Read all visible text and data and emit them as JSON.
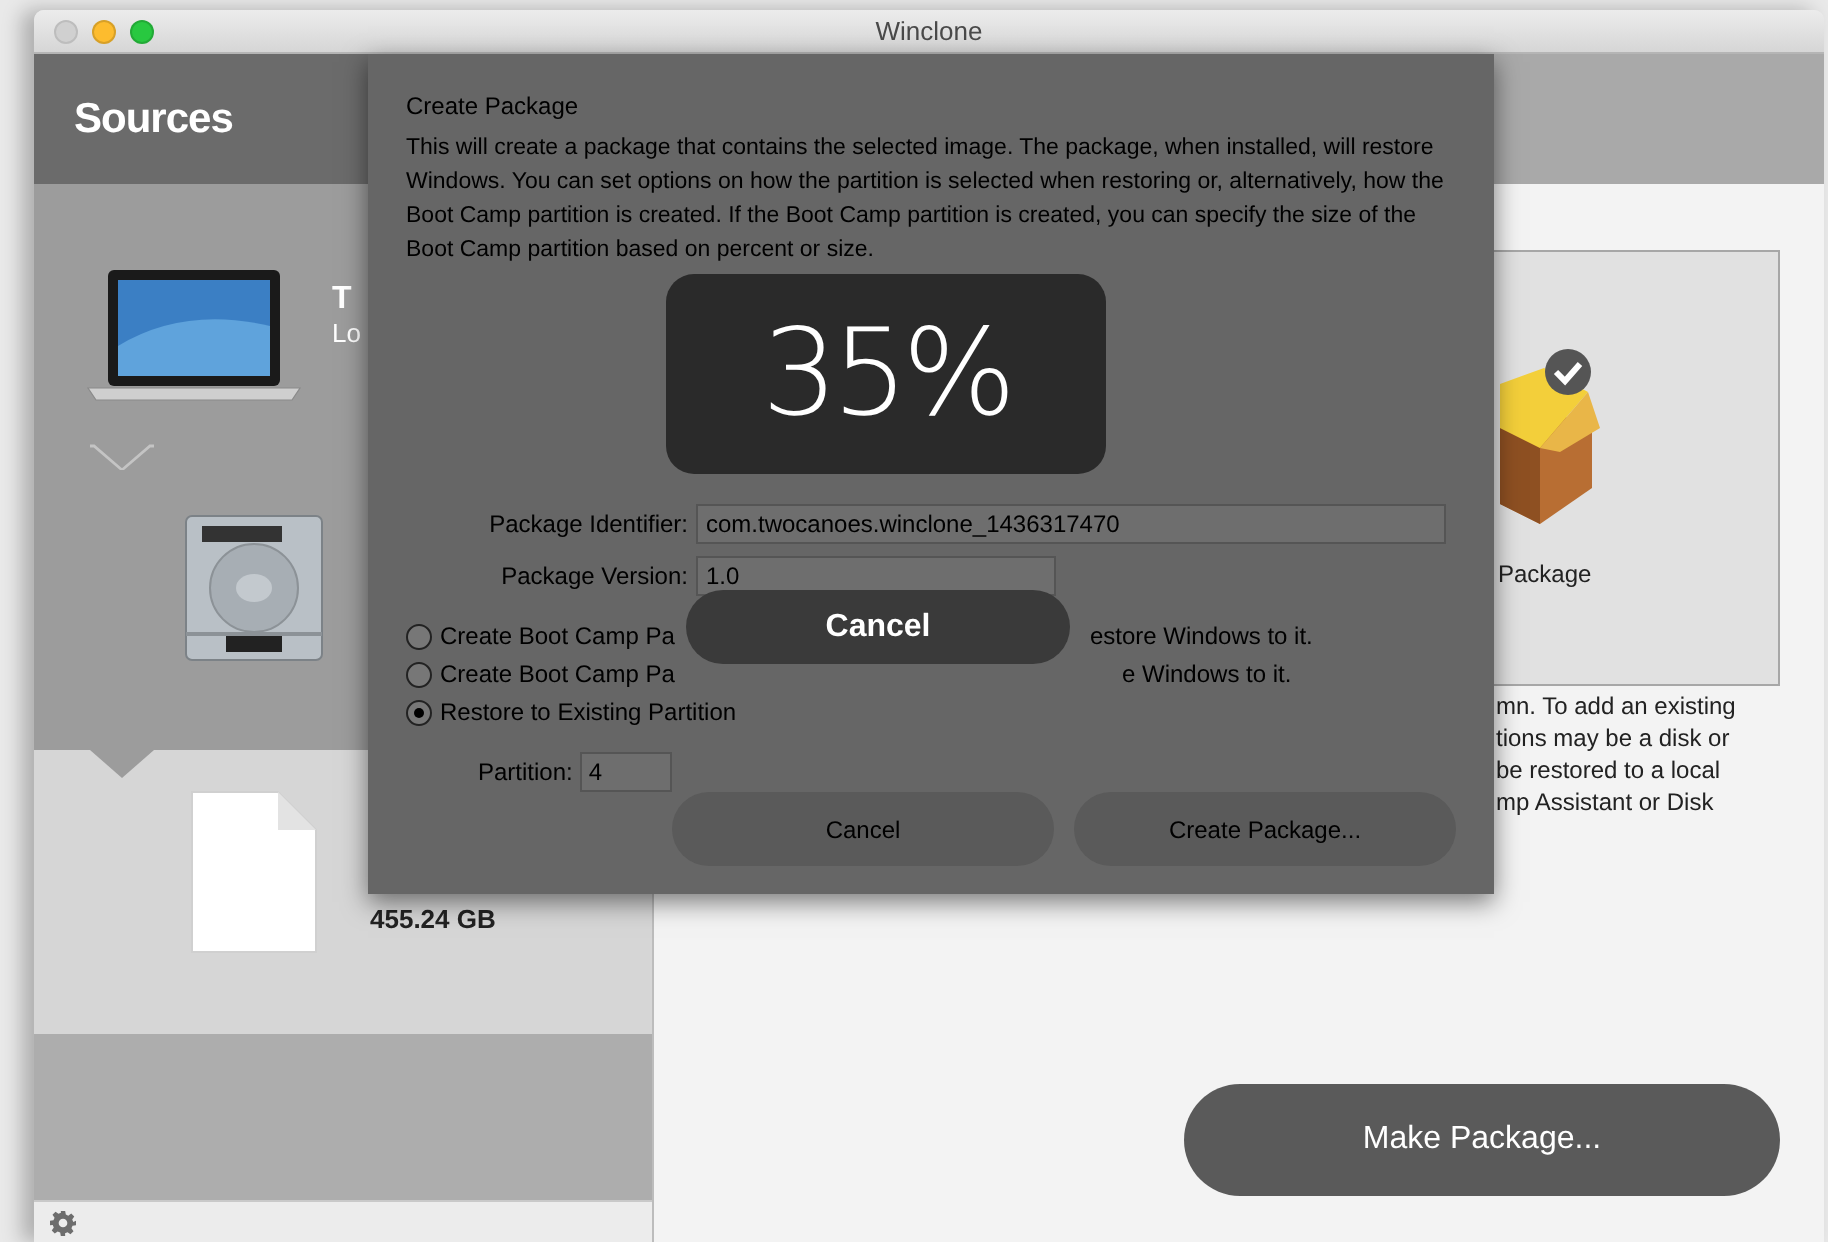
{
  "window": {
    "title": "Winclone",
    "controls": [
      {
        "kind": "close",
        "enabled": false
      },
      {
        "kind": "minimize",
        "enabled": true
      },
      {
        "kind": "zoom",
        "enabled": true
      }
    ]
  },
  "sidebar": {
    "title": "Sources",
    "items": [
      {
        "kind": "laptop",
        "title": "T",
        "subtitle": "Lo",
        "selected": false
      },
      {
        "kind": "disk",
        "selected": false
      },
      {
        "kind": "file",
        "size": "455.24 GB",
        "selected": true
      }
    ]
  },
  "main": {
    "drop_zone": {
      "label": "Package",
      "checked": true
    },
    "help_lines": [
      "mn.  To add an existing",
      "tions may be a disk or",
      "be restored to a local",
      "mp Assistant or Disk"
    ],
    "make_button": "Make Package..."
  },
  "sheet": {
    "title": "Create Package",
    "description": "This will create a package that contains the selected image.  The package, when installed, will restore Windows.  You can set options on how the partition is selected when restoring or, alternatively, how the Boot Camp partition is created.  If the Boot Camp partition is created, you can specify the size of the Boot Camp partition based on percent or size.",
    "fields": [
      {
        "label": "Package Identifier:",
        "value": "com.twocanoes.winclone_1436317470"
      },
      {
        "label": "Package Version:",
        "value": "1.0"
      }
    ],
    "options": [
      {
        "label": "Create Boot Camp Pa",
        "tail": "estore Windows to it.",
        "selected": false
      },
      {
        "label": "Create Boot Camp Pa",
        "tail": "e Windows to it.",
        "selected": false
      },
      {
        "label": "Restore to Existing Partition",
        "selected": true
      }
    ],
    "partition": {
      "label": "Partition:",
      "value": "4"
    },
    "buttons": [
      "Cancel",
      "Create Package..."
    ]
  },
  "progress": {
    "percent": "35%",
    "cancel": "Cancel"
  }
}
